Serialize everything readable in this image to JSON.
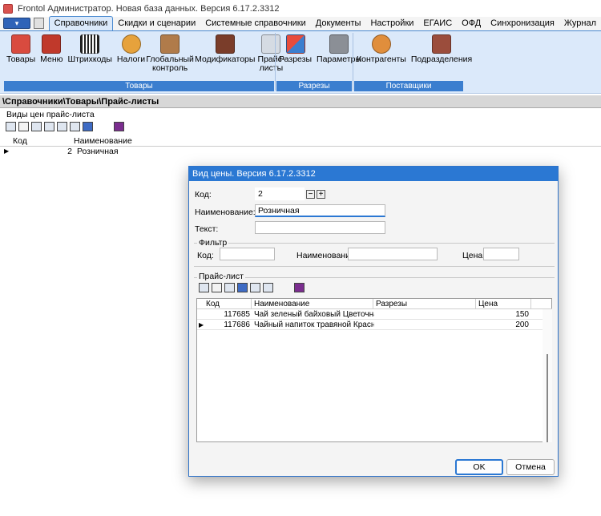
{
  "window": {
    "title": "Frontol Администратор. Новая база данных. Версия 6.17.2.3312"
  },
  "menu": {
    "tabs": [
      "Справочники",
      "Скидки и сценарии",
      "Системные справочники",
      "Документы",
      "Настройки",
      "ЕГАИС",
      "ОФД",
      "Синхронизация",
      "Журнал"
    ],
    "active_tab": "Справочники"
  },
  "ribbon": {
    "groups": [
      {
        "label": "Товары",
        "items": [
          "Товары",
          "Меню",
          "Штрихкоды",
          "Налоги",
          "Глобальный контроль",
          "Модификаторы",
          "Прайс-листы"
        ]
      },
      {
        "label": "Разрезы",
        "items": [
          "Разрезы",
          "Параметры"
        ]
      },
      {
        "label": "Поставщики",
        "items": [
          "Контрагенты",
          "Подразделения"
        ]
      }
    ]
  },
  "breadcrumb": "\\Справочники\\Товары\\Прайс-листы",
  "section_label": "Виды цен прайс-листа",
  "main_grid": {
    "columns": [
      "Код",
      "Наименование"
    ],
    "rows": [
      {
        "code": "2",
        "name": "Розничная"
      }
    ]
  },
  "dialog": {
    "title": "Вид цены. Версия 6.17.2.3312",
    "code_label": "Код:",
    "code_value": "2",
    "name_label": "Наименование:",
    "name_value": "Розничная",
    "text_label": "Текст:",
    "text_value": "",
    "filter": {
      "legend": "Фильтр",
      "code_label": "Код:",
      "name_label": "Наименование:",
      "price_label": "Цена:"
    },
    "pricelist": {
      "legend": "Прайс-лист",
      "columns": [
        "Код",
        "Наименование",
        "Разрезы",
        "Цена"
      ],
      "rows": [
        {
          "code": "117685",
          "name": "Чай зеленый байховый Цветочная сен",
          "cuts": "",
          "price": "150"
        },
        {
          "code": "117686",
          "name": "Чайный напиток травяной Краснопля",
          "cuts": "",
          "price": "200"
        }
      ]
    },
    "ok_label": "OK",
    "cancel_label": "Отмена"
  },
  "colors": {
    "accent": "#2b78d3",
    "ribbon_bg": "#dbe9fa",
    "group_label_bg": "#3b7ecf"
  }
}
